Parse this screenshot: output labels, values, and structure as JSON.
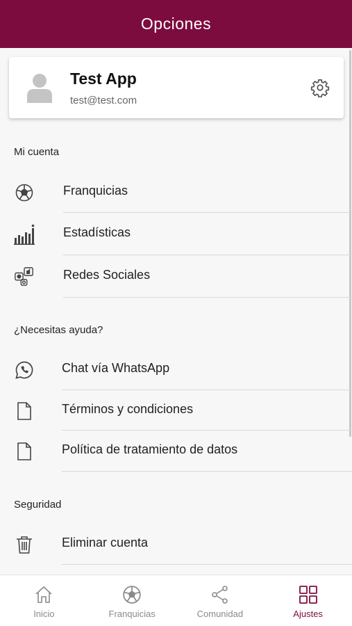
{
  "header": {
    "title": "Opciones"
  },
  "profile": {
    "name": "Test App",
    "email": "test@test.com"
  },
  "sections": {
    "account": {
      "title": "Mi cuenta",
      "items": [
        {
          "label": "Franquicias",
          "icon": "soccer-ball-icon"
        },
        {
          "label": "Estadísticas",
          "icon": "bar-chart-icon"
        },
        {
          "label": "Redes Sociales",
          "icon": "social-media-icon"
        }
      ]
    },
    "help": {
      "title": "¿Necesitas ayuda?",
      "items": [
        {
          "label": "Chat vía WhatsApp",
          "icon": "whatsapp-icon"
        },
        {
          "label": "Términos y condiciones",
          "icon": "document-icon"
        },
        {
          "label": "Política de tratamiento de datos",
          "icon": "document-icon"
        }
      ]
    },
    "security": {
      "title": "Seguridad",
      "items": [
        {
          "label": "Eliminar cuenta",
          "icon": "trash-icon"
        }
      ]
    }
  },
  "bottom_nav": {
    "items": [
      {
        "label": "Inicio",
        "icon": "home-icon"
      },
      {
        "label": "Franquicias",
        "icon": "soccer-ball-icon"
      },
      {
        "label": "Comunidad",
        "icon": "share-icon"
      },
      {
        "label": "Ajustes",
        "icon": "grid-icon"
      }
    ],
    "active": "Ajustes"
  },
  "colors": {
    "primary": "#7d0c3e",
    "background": "#f7f7f7",
    "nav_inactive": "#8a8a8a"
  }
}
